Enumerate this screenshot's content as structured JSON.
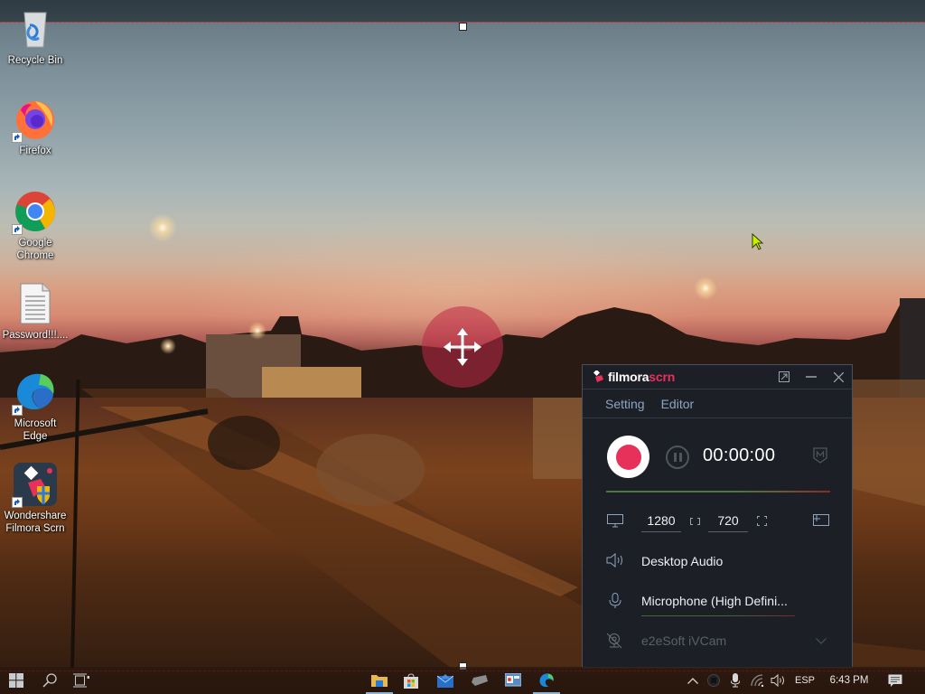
{
  "desktop": {
    "icons": [
      {
        "label": "Recycle Bin",
        "icon": "recycle-bin-icon"
      },
      {
        "label": "Firefox",
        "icon": "firefox-icon"
      },
      {
        "label": "Google Chrome",
        "icon": "chrome-icon"
      },
      {
        "label": "Password!!!....",
        "icon": "text-document-icon"
      },
      {
        "label": "Microsoft Edge",
        "icon": "edge-icon"
      },
      {
        "label": "Wondershare Filmora Scrn",
        "icon": "filmora-scrn-icon"
      }
    ]
  },
  "recorder_overlay": {
    "move_handle_icon": "move-arrows-icon",
    "region_border_color": "#e0262a"
  },
  "filmora": {
    "logo_white": "filmora",
    "logo_red": "scrn",
    "window_buttons": [
      "expand-icon",
      "minimize-icon",
      "close-icon"
    ],
    "menu": [
      "Setting",
      "Editor"
    ],
    "timer": "00:00:00",
    "width": "1280",
    "height": "720",
    "audio_source": "Desktop Audio",
    "microphone": "Microphone (High Defini...",
    "camera": "e2eSoft iVCam",
    "colors": {
      "accent": "#e8315a",
      "panel_bg": "#1c2026",
      "menu_text": "#8ea4c0"
    }
  },
  "taskbar": {
    "pinned": [
      "file-explorer-icon",
      "microsoft-store-icon",
      "mail-icon",
      "app-icon",
      "remote-desktop-icon",
      "edge-icon"
    ],
    "tray": {
      "language": "ESP",
      "time": "6:43 PM"
    }
  }
}
